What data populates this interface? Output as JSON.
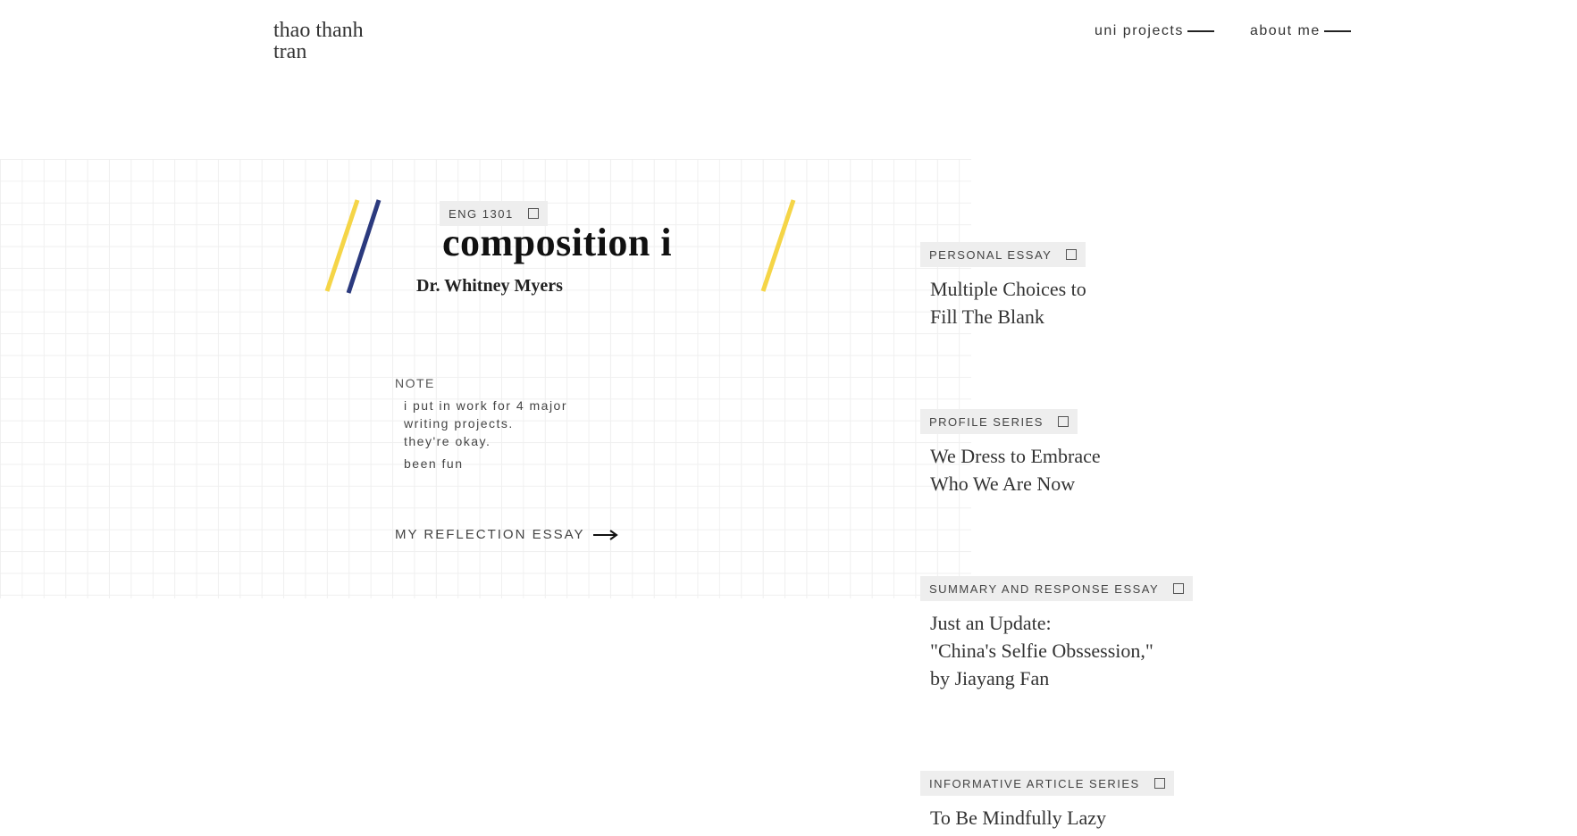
{
  "logo": {
    "line1": "thao thanh",
    "line2": "tran"
  },
  "nav": {
    "items": [
      {
        "label": "uni projects"
      },
      {
        "label": "about me"
      }
    ]
  },
  "course": {
    "code": "ENG 1301",
    "title": "composition i",
    "instructor": "Dr. Whitney Myers"
  },
  "note": {
    "label": "NOTE",
    "lines": [
      "i put in work for 4 major",
      "writing projects.",
      "they're okay."
    ],
    "extra": "been fun"
  },
  "reflection": {
    "label": "MY REFLECTION ESSAY"
  },
  "colors": {
    "accent_yellow": "#f5d547",
    "accent_navy": "#2b3a7e"
  },
  "essays": [
    {
      "tag": "PERSONAL ESSAY",
      "title_lines": [
        "Multiple Choices to",
        "Fill The Blank"
      ]
    },
    {
      "tag": "PROFILE SERIES",
      "title_lines": [
        "We Dress to Embrace",
        "Who We Are Now"
      ]
    },
    {
      "tag": "SUMMARY AND RESPONSE ESSAY",
      "title_lines": [
        "Just an Update:",
        "\"China's Selfie Obssession,\"",
        "by Jiayang Fan"
      ]
    },
    {
      "tag": "INFORMATIVE ARTICLE SERIES",
      "title_lines": [
        "To Be Mindfully Lazy"
      ]
    }
  ]
}
